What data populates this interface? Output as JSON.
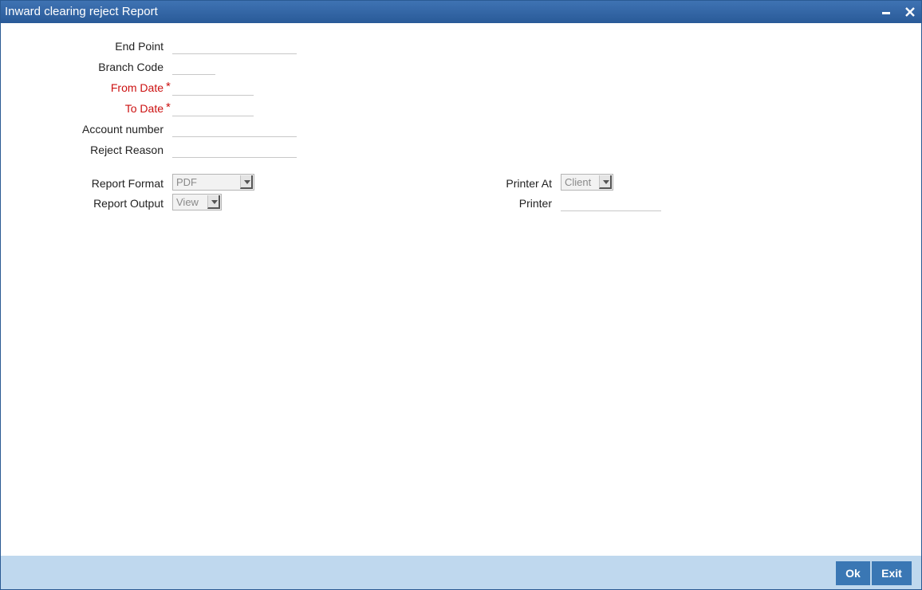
{
  "window": {
    "title": "Inward clearing reject Report"
  },
  "form": {
    "end_point": {
      "label": "End Point",
      "value": ""
    },
    "branch_code": {
      "label": "Branch Code",
      "value": ""
    },
    "from_date": {
      "label": "From Date",
      "required_mark": "*",
      "value": ""
    },
    "to_date": {
      "label": "To Date",
      "required_mark": "*",
      "value": ""
    },
    "account_number": {
      "label": "Account number",
      "value": ""
    },
    "reject_reason": {
      "label": "Reject Reason",
      "value": ""
    }
  },
  "report": {
    "format": {
      "label": "Report Format",
      "value": "PDF"
    },
    "output": {
      "label": "Report Output",
      "value": "View"
    },
    "printer_at": {
      "label": "Printer At",
      "value": "Client"
    },
    "printer": {
      "label": "Printer",
      "value": ""
    }
  },
  "footer": {
    "ok_label": "Ok",
    "exit_label": "Exit"
  },
  "colors": {
    "title_bar": "#3366a8",
    "footer": "#bfd8ee",
    "button": "#3a77b4",
    "required": "#cc1111"
  },
  "icons": {
    "minimize": "minimize-icon",
    "close": "close-icon",
    "dropdown": "chevron-down-icon"
  }
}
